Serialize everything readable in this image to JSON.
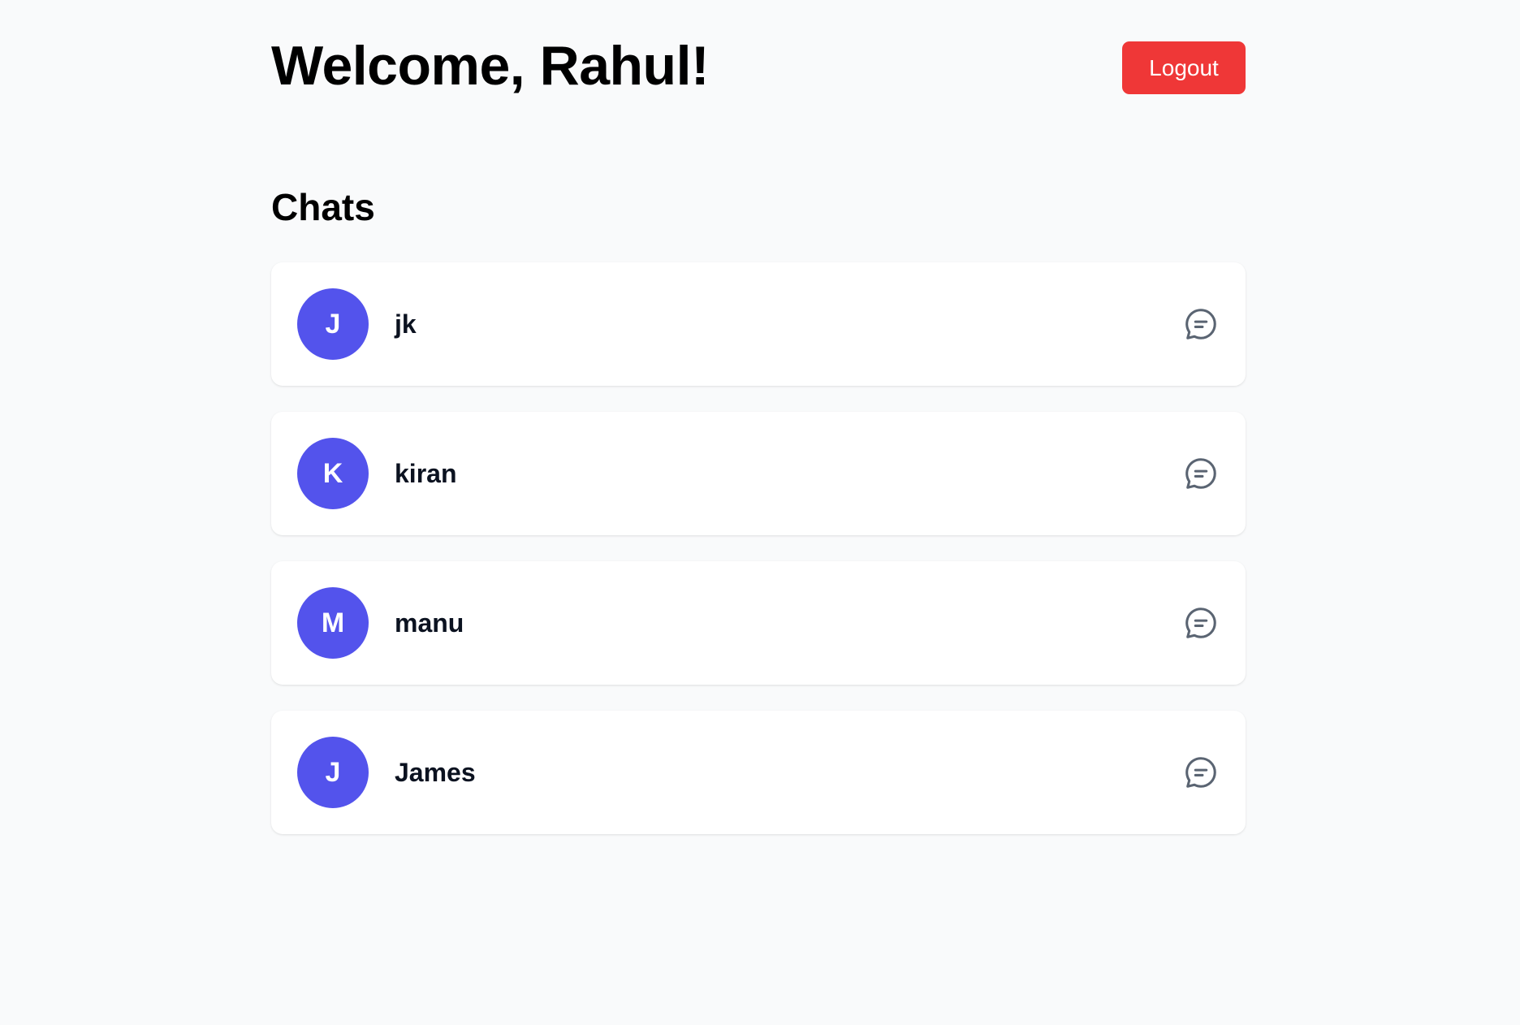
{
  "header": {
    "welcome_text": "Welcome, Rahul!",
    "logout_label": "Logout"
  },
  "chats": {
    "title": "Chats",
    "items": [
      {
        "initial": "J",
        "name": "jk",
        "icon": "chat-bubble-icon"
      },
      {
        "initial": "K",
        "name": "kiran",
        "icon": "chat-bubble-icon"
      },
      {
        "initial": "M",
        "name": "manu",
        "icon": "chat-bubble-icon"
      },
      {
        "initial": "J",
        "name": "James",
        "icon": "chat-bubble-icon"
      }
    ]
  },
  "colors": {
    "background": "#f9fafb",
    "logout_button": "#ef3737",
    "avatar": "#5353ec",
    "icon": "#5a6472"
  }
}
